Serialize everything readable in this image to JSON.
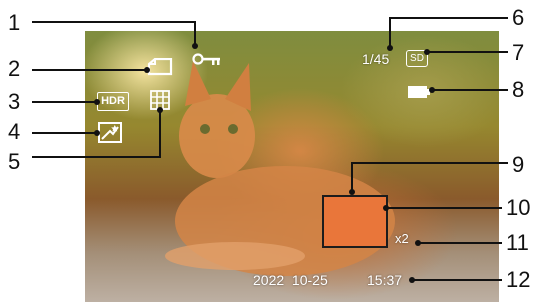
{
  "callouts": [
    "1",
    "2",
    "3",
    "4",
    "5",
    "6",
    "7",
    "8",
    "9",
    "10",
    "11",
    "12"
  ],
  "screen": {
    "shot_count": "1/45",
    "storage": "SD",
    "hdr_label": "HDR",
    "zoom": "x2",
    "date": "2022  10-25",
    "time": "15:37"
  },
  "icons": [
    "key-icon",
    "document-icon",
    "hdr-icon",
    "face-beauty-icon",
    "grid-icon",
    "sd-card-icon",
    "battery-icon",
    "focus-frame"
  ],
  "colors": {
    "focus_frame": "#e9763a",
    "lines": "#111111"
  }
}
